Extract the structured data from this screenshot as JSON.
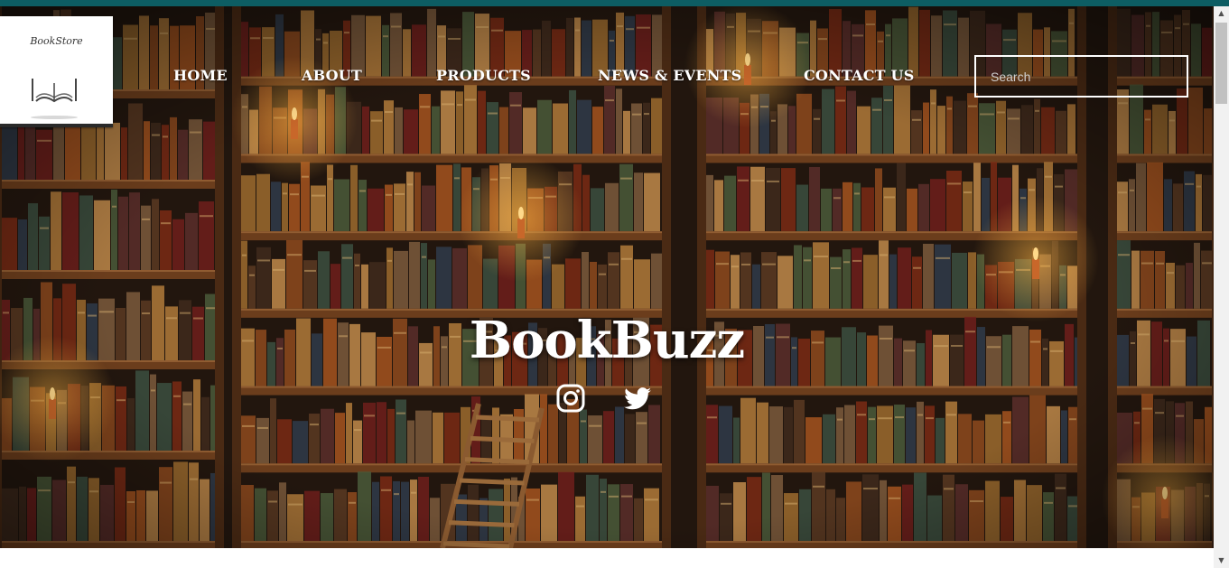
{
  "logo": {
    "text": "BookStore",
    "alt": "book-logo"
  },
  "nav": {
    "items": [
      {
        "label": "HOME"
      },
      {
        "label": "ABOUT"
      },
      {
        "label": "PRODUCTS"
      },
      {
        "label": "NEWS & EVENTS"
      },
      {
        "label": "CONTACT US"
      }
    ]
  },
  "search": {
    "placeholder": "Search",
    "value": ""
  },
  "hero": {
    "title": "BookBuzz"
  },
  "social": [
    {
      "icon": "instagram-icon"
    },
    {
      "icon": "twitter-icon"
    }
  ],
  "colors": {
    "topbar": "#0d5d63",
    "hero_bg": "#1e120a",
    "shelf": "#6b3d1c",
    "text": "#ffffff"
  }
}
